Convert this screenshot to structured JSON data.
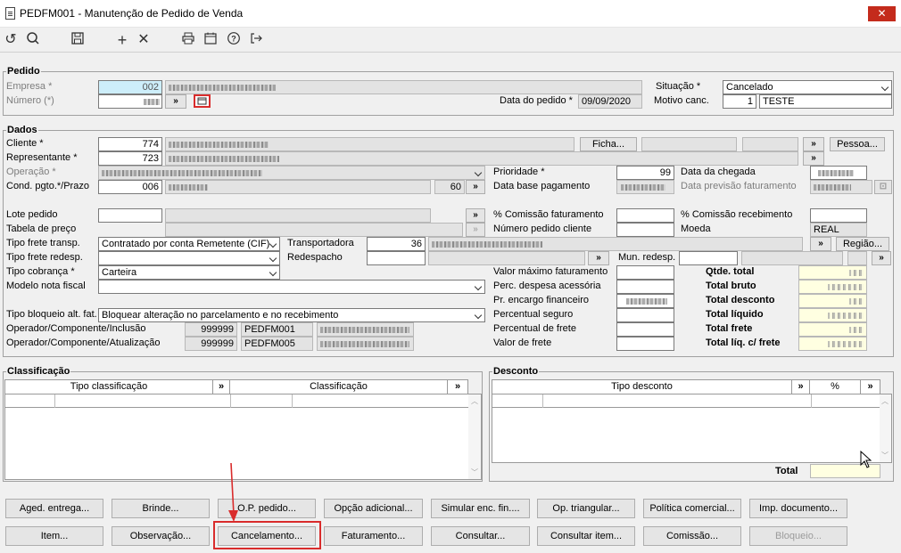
{
  "window": {
    "title": "PEDFM001 - Manutenção de Pedido de Venda",
    "close": "✕"
  },
  "toolbar": [
    {
      "name": "undo-icon",
      "glyph": "↺"
    },
    {
      "name": "search-icon",
      "glyph": "🔍"
    },
    {
      "name": "save-icon",
      "glyph": "💾"
    },
    {
      "name": "add-icon",
      "glyph": "+"
    },
    {
      "name": "cancel-icon",
      "glyph": "✕"
    },
    {
      "name": "print-icon",
      "glyph": "⎙"
    },
    {
      "name": "calendar-icon",
      "glyph": "▦"
    },
    {
      "name": "help-icon",
      "glyph": "?"
    },
    {
      "name": "exit-icon",
      "glyph": "⇥"
    }
  ],
  "pedido": {
    "title": "Pedido",
    "empresa_label": "Empresa *",
    "empresa_value": "002",
    "numero_label": "Número (*)",
    "data_label": "Data do pedido *",
    "data_value": "09/09/2020",
    "situacao_label": "Situação *",
    "situacao_value": "Cancelado",
    "motivo_label": "Motivo canc.",
    "motivo_code": "1",
    "motivo_text": "TESTE",
    "arrow": "»"
  },
  "dados": {
    "title": "Dados",
    "cliente_label": "Cliente *",
    "cliente_value": "774",
    "ficha": "Ficha...",
    "pessoa": "Pessoa...",
    "representante_label": "Representante *",
    "representante_value": "723",
    "operacao_label": "Operação *",
    "prioridade_label": "Prioridade *",
    "prioridade_value": "99",
    "chegada_label": "Data da chegada",
    "cond_label": "Cond. pgto.*/Prazo",
    "cond_value": "006",
    "prazo_value": "60",
    "base_label": "Data base pagamento",
    "previsao_label": "Data previsão faturamento",
    "lote_label": "Lote pedido",
    "comissao_fat_label": "% Comissão faturamento",
    "comissao_rec_label": "% Comissão recebimento",
    "tabela_label": "Tabela de preço",
    "num_cliente_label": "Número pedido cliente",
    "moeda_label": "Moeda",
    "moeda_value": "REAL",
    "frete_transp_label": "Tipo frete transp.",
    "frete_transp_value": "Contratado por conta Remetente (CIF)",
    "transportadora_label": "Transportadora",
    "transportadora_value": "36",
    "regiao": "Região...",
    "frete_redesp_label": "Tipo frete redesp.",
    "redespacho_label": "Redespacho",
    "mun_redesp_label": "Mun. redesp.",
    "cobranca_label": "Tipo cobrança *",
    "cobranca_value": "Carteira",
    "valor_max_label": "Valor máximo faturamento",
    "qtde_label": "Qtde. total",
    "modelo_label": "Modelo nota fiscal",
    "perc_despesa_label": "Perc. despesa acessória",
    "bruto_label": "Total bruto",
    "encargo_label": "Pr. encargo financeiro",
    "desconto_label": "Total desconto",
    "bloqueio_label": "Tipo bloqueio alt. fat.",
    "bloqueio_value": "Bloquear alteração no parcelamento e no recebimento",
    "seguro_label": "Percentual seguro",
    "liquido_label": "Total líquido",
    "op_inclusao_label": "Operador/Componente/Inclusão",
    "op_inclusao_code": "999999",
    "op_inclusao_prog": "PEDFM001",
    "perc_frete_label": "Percentual de frete",
    "total_frete_label": "Total frete",
    "op_atualiz_label": "Operador/Componente/Atualização",
    "op_atualiz_code": "999999",
    "op_atualiz_prog": "PEDFM005",
    "valor_frete_label": "Valor de frete",
    "liq_frete_label": "Total líq. c/ frete"
  },
  "classificacao": {
    "title": "Classificação",
    "col1": "Tipo classificação",
    "col2": "Classificação",
    "arrow": "»"
  },
  "desconto": {
    "title": "Desconto",
    "col1": "Tipo desconto",
    "col2": "%",
    "total_label": "Total",
    "arrow": "»"
  },
  "buttons_row1": [
    "Aged. entrega...",
    "Brinde...",
    "O.P. pedido...",
    "Opção adicional...",
    "Simular enc. fin....",
    "Op. triangular...",
    "Política comercial...",
    "Imp. documento..."
  ],
  "buttons_row2": [
    "Item...",
    "Observação...",
    "Cancelamento...",
    "Faturamento...",
    "Consultar...",
    "Consultar item...",
    "Comissão...",
    "Bloqueio..."
  ],
  "colors": {
    "highlight": "#d92c2c",
    "yellow": "#ffffe1",
    "cyan": "#cdeefa"
  }
}
